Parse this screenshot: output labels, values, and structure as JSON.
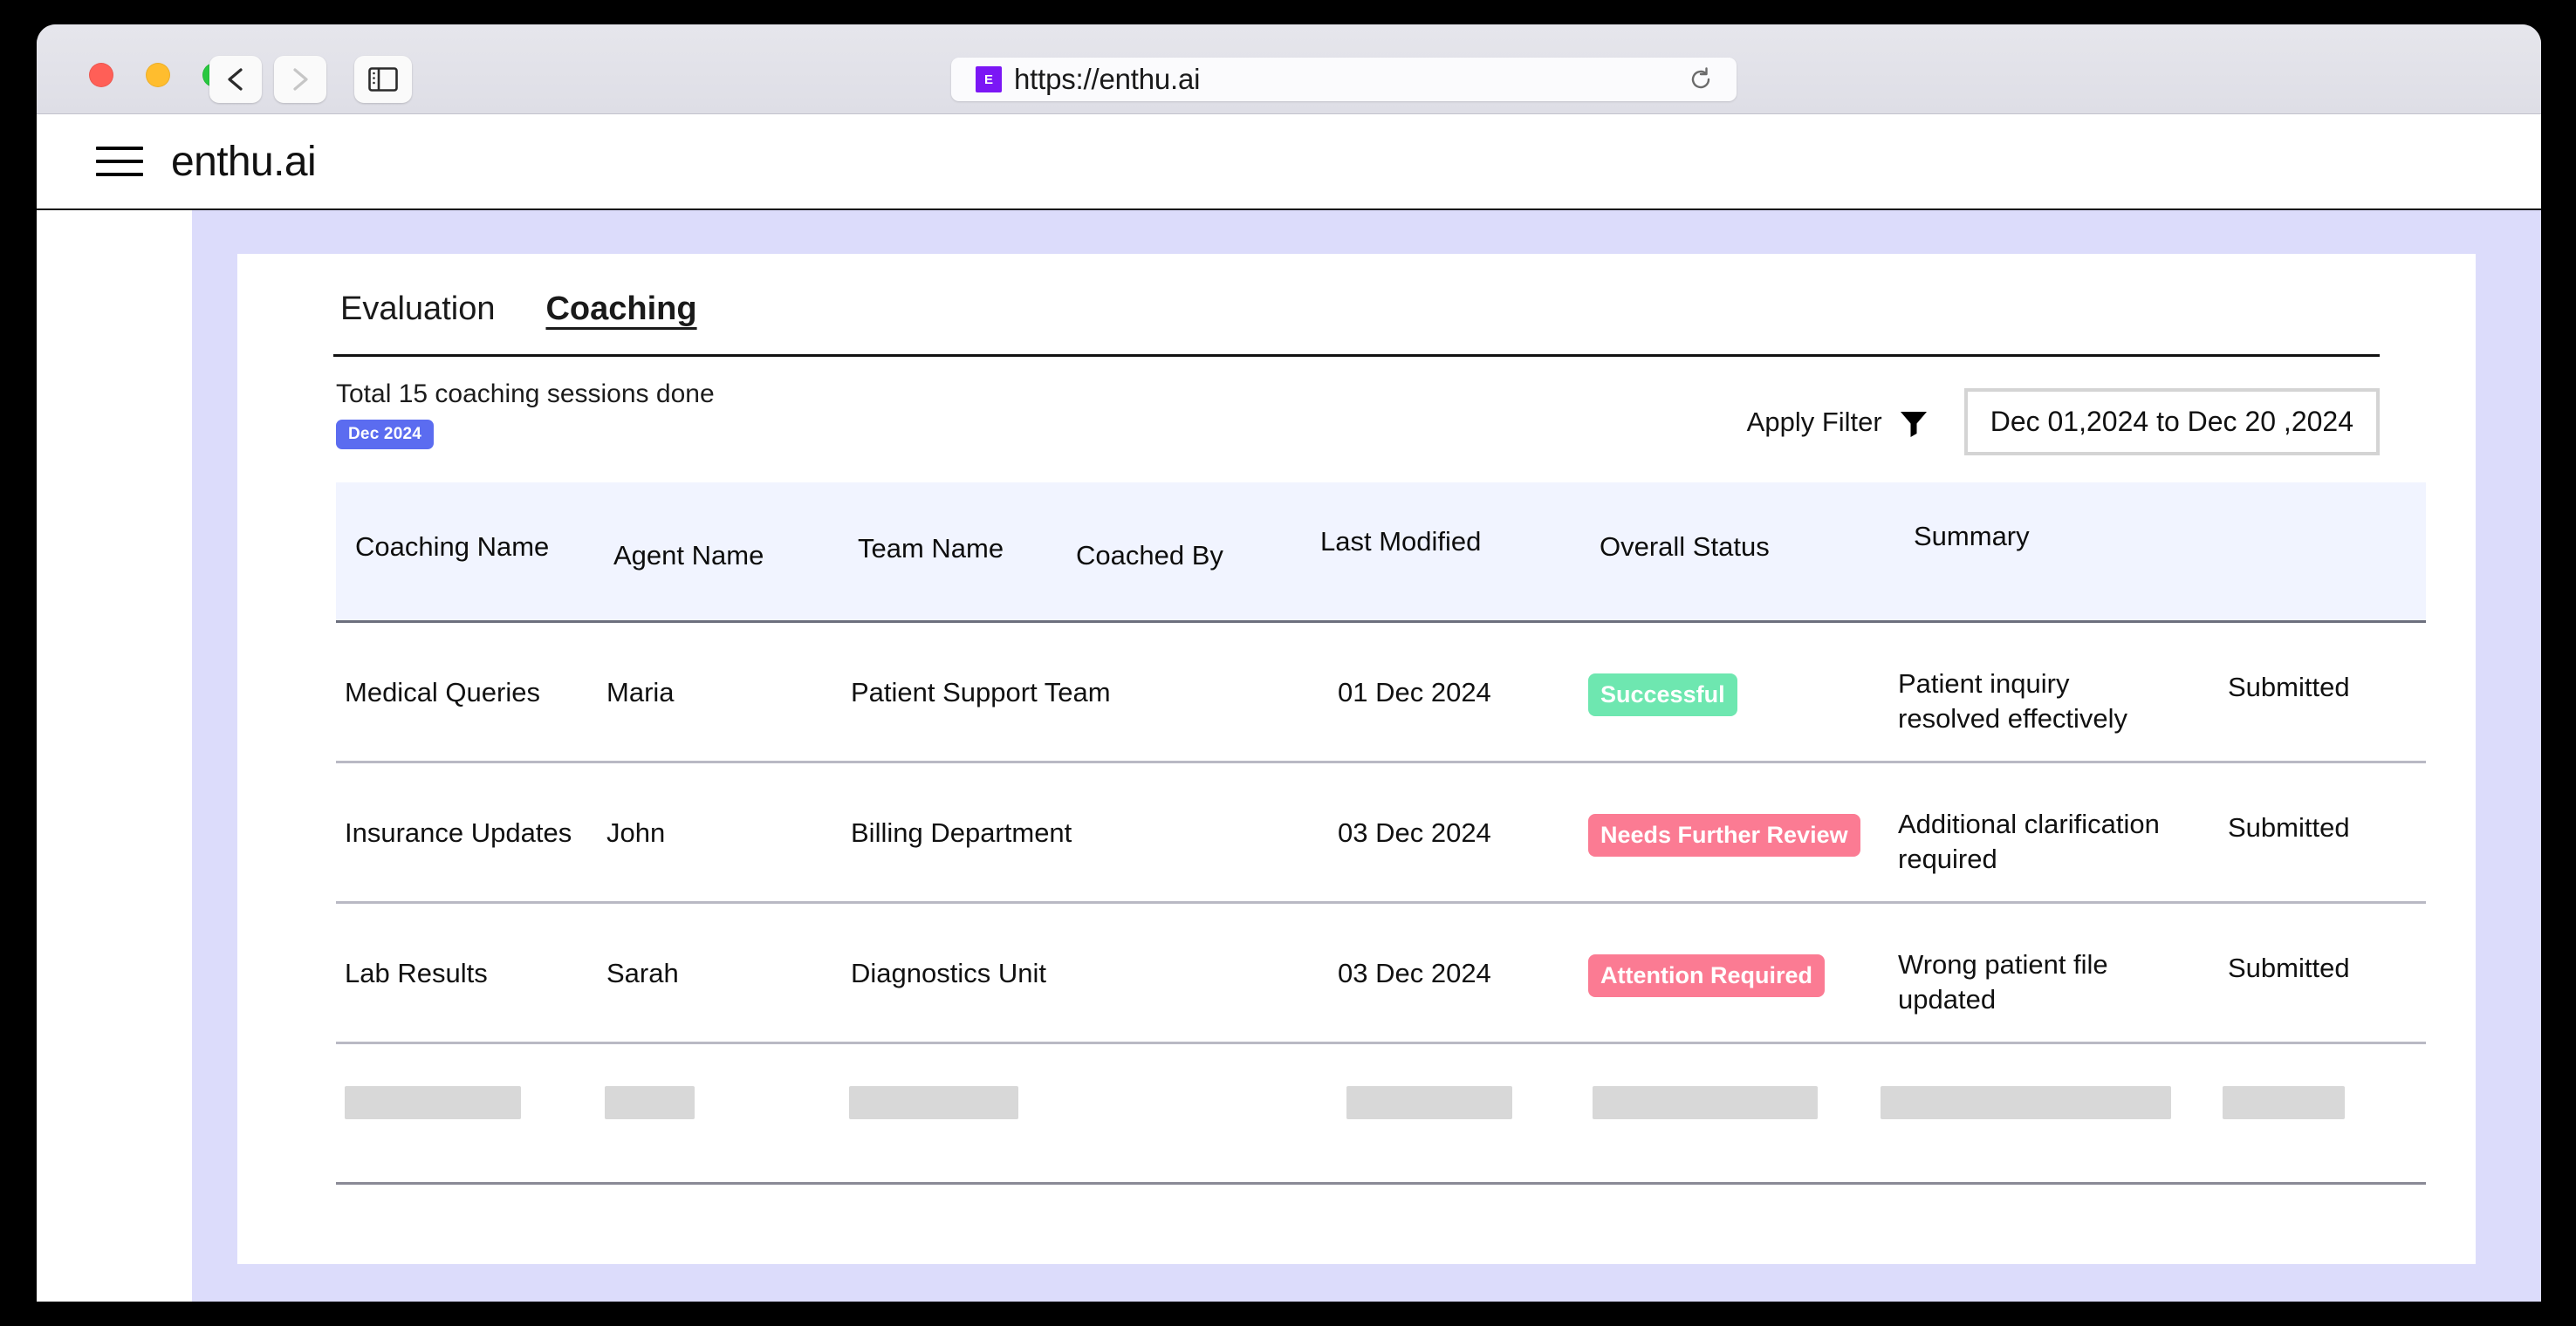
{
  "browser": {
    "url": "https://enthu.ai",
    "favicon_letter": "E",
    "back_icon": "chevron-left-icon",
    "forward_icon": "chevron-right-icon",
    "sidebar_icon": "sidebar-toggle-icon",
    "reload_icon": "reload-icon"
  },
  "app": {
    "brand": "enthu.ai",
    "menu_icon": "hamburger-menu-icon"
  },
  "tabs": [
    {
      "label": "Evaluation",
      "active": false
    },
    {
      "label": "Coaching",
      "active": true
    }
  ],
  "summary": {
    "title": "Total 15 coaching sessions done",
    "month_badge": "Dec 2024",
    "total_sessions": 15
  },
  "toolbar": {
    "apply_filter_label": "Apply Filter",
    "filter_icon": "funnel-icon",
    "date_range": "Dec 01,2024 to Dec 20 ,2024"
  },
  "table": {
    "columns": [
      "Coaching Name",
      "Agent Name",
      "Team Name",
      "Coached By",
      "Last Modified",
      "Overall Status",
      "Summary",
      ""
    ],
    "rows": [
      {
        "coaching_name": "Medical Queries",
        "agent_name": "Maria",
        "team_name": "Patient Support Team",
        "coached_by": "",
        "last_modified": "01 Dec 2024",
        "overall_status": "Successful",
        "status_kind": "successful",
        "summary": "Patient inquiry resolved effectively",
        "submission": "Submitted"
      },
      {
        "coaching_name": "Insurance Updates",
        "agent_name": "John",
        "team_name": "Billing Department",
        "coached_by": "",
        "last_modified": "03 Dec 2024",
        "overall_status": "Needs Further Review",
        "status_kind": "review",
        "summary": "Additional clarification required",
        "submission": "Submitted"
      },
      {
        "coaching_name": "Lab Results",
        "agent_name": "Sarah",
        "team_name": "Diagnostics Unit",
        "coached_by": "",
        "last_modified": "03 Dec 2024",
        "overall_status": "Attention Required",
        "status_kind": "attention",
        "summary": "Wrong patient file updated",
        "submission": "Submitted"
      }
    ],
    "skeleton_row": {
      "placeholder_count": 7
    }
  },
  "colors": {
    "page_background": "#dcdcfb",
    "card_background": "#ffffff",
    "table_header_background": "#f1f4ff",
    "badge_indigo": "#5b6cf0",
    "badge_green": "#6ee7b0",
    "badge_pink": "#fb7b93",
    "favicon_purple": "#7b16f5"
  }
}
